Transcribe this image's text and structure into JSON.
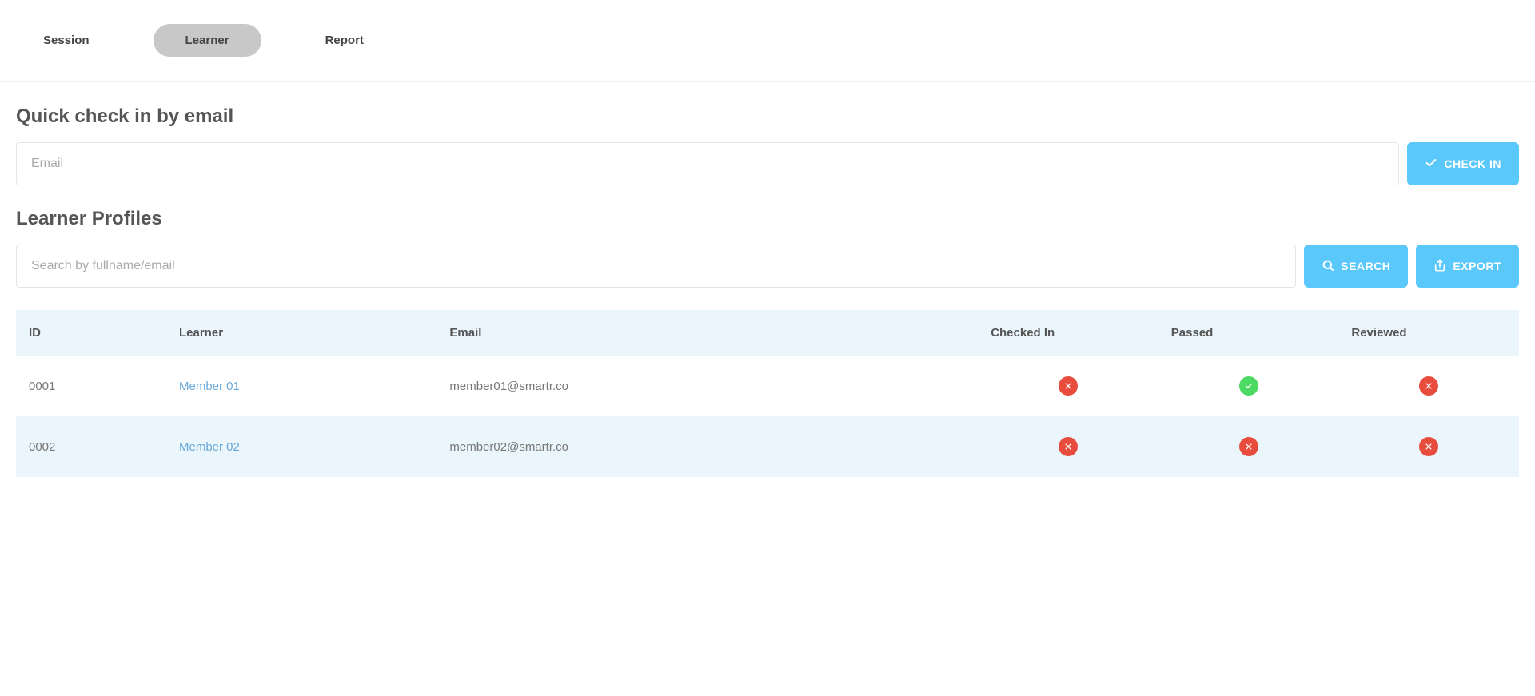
{
  "tabs": [
    {
      "label": "Session",
      "active": false
    },
    {
      "label": "Learner",
      "active": true
    },
    {
      "label": "Report",
      "active": false
    }
  ],
  "quick_check": {
    "title": "Quick check in by email",
    "email_placeholder": "Email",
    "checkin_label": "CHECK IN"
  },
  "profiles": {
    "title": "Learner Profiles",
    "search_placeholder": "Search by fullname/email",
    "search_label": "SEARCH",
    "export_label": "EXPORT"
  },
  "table": {
    "headers": {
      "id": "ID",
      "learner": "Learner",
      "email": "Email",
      "checked_in": "Checked In",
      "passed": "Passed",
      "reviewed": "Reviewed"
    },
    "rows": [
      {
        "id": "0001",
        "learner": "Member 01",
        "email": "member01@smartr.co",
        "checked_in": false,
        "passed": true,
        "reviewed": false
      },
      {
        "id": "0002",
        "learner": "Member 02",
        "email": "member02@smartr.co",
        "checked_in": false,
        "passed": false,
        "reviewed": false
      }
    ]
  }
}
